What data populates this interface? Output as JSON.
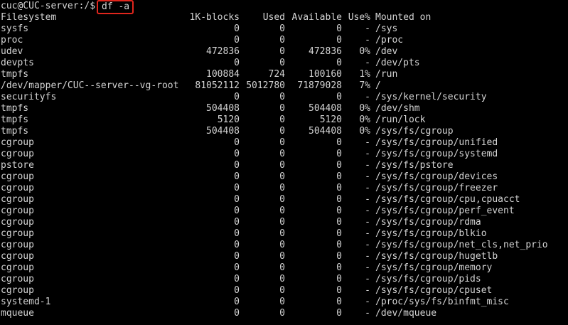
{
  "terminal": {
    "prompt": "cuc@CUC-server:/$",
    "command": "df -a",
    "colors": {
      "background": "#000000",
      "foreground": "#d4d4d4",
      "highlight": "#e0261d"
    },
    "headers": {
      "filesystem": "Filesystem",
      "blocks": "1K-blocks",
      "used": "Used",
      "available": "Available",
      "use": "Use%",
      "mounted": "Mounted on"
    },
    "rows": [
      {
        "filesystem": "sysfs",
        "blocks": "0",
        "used": "0",
        "available": "0",
        "use": "-",
        "mounted": "/sys"
      },
      {
        "filesystem": "proc",
        "blocks": "0",
        "used": "0",
        "available": "0",
        "use": "-",
        "mounted": "/proc"
      },
      {
        "filesystem": "udev",
        "blocks": "472836",
        "used": "0",
        "available": "472836",
        "use": "0%",
        "mounted": "/dev"
      },
      {
        "filesystem": "devpts",
        "blocks": "0",
        "used": "0",
        "available": "0",
        "use": "-",
        "mounted": "/dev/pts"
      },
      {
        "filesystem": "tmpfs",
        "blocks": "100884",
        "used": "724",
        "available": "100160",
        "use": "1%",
        "mounted": "/run"
      },
      {
        "filesystem": "/dev/mapper/CUC--server--vg-root",
        "blocks": "81052112",
        "used": "5012780",
        "available": "71879028",
        "use": "7%",
        "mounted": "/"
      },
      {
        "filesystem": "securityfs",
        "blocks": "0",
        "used": "0",
        "available": "0",
        "use": "-",
        "mounted": "/sys/kernel/security"
      },
      {
        "filesystem": "tmpfs",
        "blocks": "504408",
        "used": "0",
        "available": "504408",
        "use": "0%",
        "mounted": "/dev/shm"
      },
      {
        "filesystem": "tmpfs",
        "blocks": "5120",
        "used": "0",
        "available": "5120",
        "use": "0%",
        "mounted": "/run/lock"
      },
      {
        "filesystem": "tmpfs",
        "blocks": "504408",
        "used": "0",
        "available": "504408",
        "use": "0%",
        "mounted": "/sys/fs/cgroup"
      },
      {
        "filesystem": "cgroup",
        "blocks": "0",
        "used": "0",
        "available": "0",
        "use": "-",
        "mounted": "/sys/fs/cgroup/unified"
      },
      {
        "filesystem": "cgroup",
        "blocks": "0",
        "used": "0",
        "available": "0",
        "use": "-",
        "mounted": "/sys/fs/cgroup/systemd"
      },
      {
        "filesystem": "pstore",
        "blocks": "0",
        "used": "0",
        "available": "0",
        "use": "-",
        "mounted": "/sys/fs/pstore"
      },
      {
        "filesystem": "cgroup",
        "blocks": "0",
        "used": "0",
        "available": "0",
        "use": "-",
        "mounted": "/sys/fs/cgroup/devices"
      },
      {
        "filesystem": "cgroup",
        "blocks": "0",
        "used": "0",
        "available": "0",
        "use": "-",
        "mounted": "/sys/fs/cgroup/freezer"
      },
      {
        "filesystem": "cgroup",
        "blocks": "0",
        "used": "0",
        "available": "0",
        "use": "-",
        "mounted": "/sys/fs/cgroup/cpu,cpuacct"
      },
      {
        "filesystem": "cgroup",
        "blocks": "0",
        "used": "0",
        "available": "0",
        "use": "-",
        "mounted": "/sys/fs/cgroup/perf_event"
      },
      {
        "filesystem": "cgroup",
        "blocks": "0",
        "used": "0",
        "available": "0",
        "use": "-",
        "mounted": "/sys/fs/cgroup/rdma"
      },
      {
        "filesystem": "cgroup",
        "blocks": "0",
        "used": "0",
        "available": "0",
        "use": "-",
        "mounted": "/sys/fs/cgroup/blkio"
      },
      {
        "filesystem": "cgroup",
        "blocks": "0",
        "used": "0",
        "available": "0",
        "use": "-",
        "mounted": "/sys/fs/cgroup/net_cls,net_prio"
      },
      {
        "filesystem": "cgroup",
        "blocks": "0",
        "used": "0",
        "available": "0",
        "use": "-",
        "mounted": "/sys/fs/cgroup/hugetlb"
      },
      {
        "filesystem": "cgroup",
        "blocks": "0",
        "used": "0",
        "available": "0",
        "use": "-",
        "mounted": "/sys/fs/cgroup/memory"
      },
      {
        "filesystem": "cgroup",
        "blocks": "0",
        "used": "0",
        "available": "0",
        "use": "-",
        "mounted": "/sys/fs/cgroup/pids"
      },
      {
        "filesystem": "cgroup",
        "blocks": "0",
        "used": "0",
        "available": "0",
        "use": "-",
        "mounted": "/sys/fs/cgroup/cpuset"
      },
      {
        "filesystem": "systemd-1",
        "blocks": "0",
        "used": "0",
        "available": "0",
        "use": "-",
        "mounted": "/proc/sys/fs/binfmt_misc"
      },
      {
        "filesystem": "mqueue",
        "blocks": "0",
        "used": "0",
        "available": "0",
        "use": "-",
        "mounted": "/dev/mqueue"
      }
    ]
  }
}
